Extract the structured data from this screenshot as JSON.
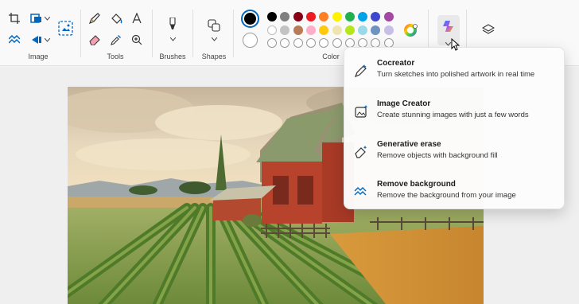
{
  "ribbon": {
    "groups": {
      "image": "Image",
      "tools": "Tools",
      "brushes": "Brushes",
      "shapes": "Shapes",
      "color": "Color"
    }
  },
  "icons": {
    "crop": "crop-icon",
    "resize": "resize-icon",
    "rotate": "rotate-icon",
    "select": "select-icon",
    "pencil": "pencil-icon",
    "fill": "fill-icon",
    "text": "text-icon",
    "eraser": "eraser-icon",
    "picker": "color-picker-icon",
    "magnifier": "magnifier-icon",
    "brush": "brush-icon",
    "shapes": "shapes-icon",
    "copilot": "copilot-icon",
    "layers": "layers-icon"
  },
  "colors": {
    "primary": "#000000",
    "secondary": "#ffffff",
    "palette_row1": [
      "#000000",
      "#7f7f7f",
      "#880015",
      "#ed1c24",
      "#ff7f27",
      "#fff200",
      "#22b14c",
      "#00a2e8",
      "#3f48cc",
      "#a349a4"
    ],
    "palette_row2": [
      "#ffffff",
      "#c3c3c3",
      "#b97a57",
      "#ffaec9",
      "#ffc90e",
      "#efe4b0",
      "#b5e61d",
      "#99d9ea",
      "#7092be",
      "#c8bfe7"
    ],
    "accent": "#0067c0"
  },
  "menu": {
    "items": [
      {
        "title": "Cocreator",
        "desc": "Turn sketches into polished artwork in real time",
        "icon": "cocreator-icon"
      },
      {
        "title": "Image Creator",
        "desc": "Create stunning images with just a few words",
        "icon": "image-creator-icon"
      },
      {
        "title": "Generative erase",
        "desc": "Remove objects with background fill",
        "icon": "generative-erase-icon"
      },
      {
        "title": "Remove background",
        "desc": "Remove the background from your image",
        "icon": "remove-background-icon"
      }
    ]
  }
}
